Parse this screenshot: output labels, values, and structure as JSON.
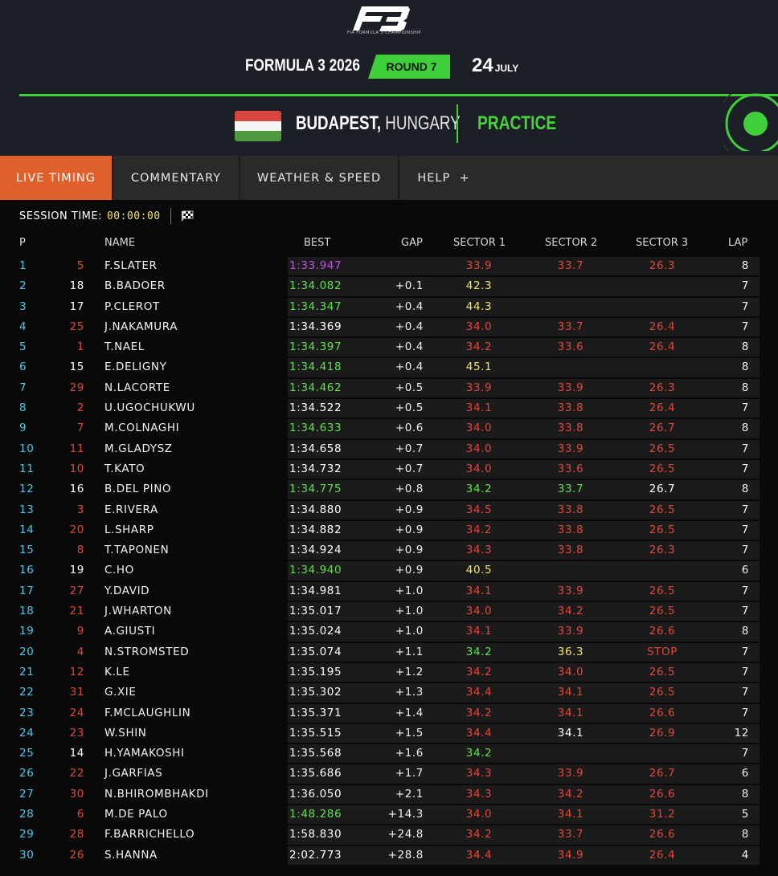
{
  "header": {
    "logo_text": "F3",
    "logo_sub": "FIA FORMULA 3 CHAMPIONSHIP",
    "season": "FORMULA 3 2026",
    "round": "ROUND 7",
    "day": "24",
    "month": "JULY",
    "city": "BUDAPEST,",
    "country": "HUNGARY",
    "session": "PRACTICE"
  },
  "colors": {
    "accent_green": "#3ecf3a",
    "active_tab": "#e0602c",
    "purple": "#c44fe0",
    "green": "#5ee04f",
    "yellow": "#f4e46a",
    "red": "#e0473b",
    "white": "#ffffff",
    "cyan": "#4ac9e6"
  },
  "tabs": [
    "LIVE TIMING",
    "COMMENTARY",
    "WEATHER & SPEED",
    "HELP  +"
  ],
  "session_bar": {
    "label": "SESSION TIME:",
    "time": "00:00:00",
    "icon": "checkered-flag-icon"
  },
  "columns": {
    "pos": "P",
    "name": "NAME",
    "best": "BEST",
    "gap": "GAP",
    "s1": "SECTOR 1",
    "s2": "SECTOR 2",
    "s3": "SECTOR 3",
    "lap": "LAP"
  },
  "rows": [
    {
      "pos": "1",
      "num": "5",
      "num_c": "red",
      "name": "F.SLATER",
      "best": "1:33.947",
      "best_c": "purple",
      "gap": "",
      "s1": "33.9",
      "s1_c": "red",
      "s2": "33.7",
      "s2_c": "red",
      "s3": "26.3",
      "s3_c": "red",
      "lap": "8"
    },
    {
      "pos": "2",
      "num": "18",
      "num_c": "white",
      "name": "B.BADOER",
      "best": "1:34.082",
      "best_c": "green",
      "gap": "+0.1",
      "s1": "42.3",
      "s1_c": "yellow",
      "s2": "",
      "s2_c": "white",
      "s3": "",
      "s3_c": "white",
      "lap": "7"
    },
    {
      "pos": "3",
      "num": "17",
      "num_c": "white",
      "name": "P.CLEROT",
      "best": "1:34.347",
      "best_c": "green",
      "gap": "+0.4",
      "s1": "44.3",
      "s1_c": "yellow",
      "s2": "",
      "s2_c": "white",
      "s3": "",
      "s3_c": "white",
      "lap": "7"
    },
    {
      "pos": "4",
      "num": "25",
      "num_c": "red",
      "name": "J.NAKAMURA",
      "best": "1:34.369",
      "best_c": "white",
      "gap": "+0.4",
      "s1": "34.0",
      "s1_c": "red",
      "s2": "33.7",
      "s2_c": "red",
      "s3": "26.4",
      "s3_c": "red",
      "lap": "7"
    },
    {
      "pos": "5",
      "num": "1",
      "num_c": "red",
      "name": "T.NAEL",
      "best": "1:34.397",
      "best_c": "green",
      "gap": "+0.4",
      "s1": "34.2",
      "s1_c": "red",
      "s2": "33.6",
      "s2_c": "red",
      "s3": "26.4",
      "s3_c": "red",
      "lap": "8"
    },
    {
      "pos": "6",
      "num": "15",
      "num_c": "white",
      "name": "E.DELIGNY",
      "best": "1:34.418",
      "best_c": "green",
      "gap": "+0.4",
      "s1": "45.1",
      "s1_c": "yellow",
      "s2": "",
      "s2_c": "white",
      "s3": "",
      "s3_c": "white",
      "lap": "8"
    },
    {
      "pos": "7",
      "num": "29",
      "num_c": "red",
      "name": "N.LACORTE",
      "best": "1:34.462",
      "best_c": "green",
      "gap": "+0.5",
      "s1": "33.9",
      "s1_c": "red",
      "s2": "33.9",
      "s2_c": "red",
      "s3": "26.3",
      "s3_c": "red",
      "lap": "8"
    },
    {
      "pos": "8",
      "num": "2",
      "num_c": "red",
      "name": "U.UGOCHUKWU",
      "best": "1:34.522",
      "best_c": "white",
      "gap": "+0.5",
      "s1": "34.1",
      "s1_c": "red",
      "s2": "33.8",
      "s2_c": "red",
      "s3": "26.4",
      "s3_c": "red",
      "lap": "7"
    },
    {
      "pos": "9",
      "num": "7",
      "num_c": "red",
      "name": "M.COLNAGHI",
      "best": "1:34.633",
      "best_c": "green",
      "gap": "+0.6",
      "s1": "34.0",
      "s1_c": "red",
      "s2": "33.8",
      "s2_c": "red",
      "s3": "26.7",
      "s3_c": "red",
      "lap": "8"
    },
    {
      "pos": "10",
      "num": "11",
      "num_c": "red",
      "name": "M.GLADYSZ",
      "best": "1:34.658",
      "best_c": "white",
      "gap": "+0.7",
      "s1": "34.0",
      "s1_c": "red",
      "s2": "33.9",
      "s2_c": "red",
      "s3": "26.5",
      "s3_c": "red",
      "lap": "7"
    },
    {
      "pos": "11",
      "num": "10",
      "num_c": "red",
      "name": "T.KATO",
      "best": "1:34.732",
      "best_c": "white",
      "gap": "+0.7",
      "s1": "34.0",
      "s1_c": "red",
      "s2": "33.6",
      "s2_c": "red",
      "s3": "26.5",
      "s3_c": "red",
      "lap": "7"
    },
    {
      "pos": "12",
      "num": "16",
      "num_c": "white",
      "name": "B.DEL PINO",
      "best": "1:34.775",
      "best_c": "green",
      "gap": "+0.8",
      "s1": "34.2",
      "s1_c": "green",
      "s2": "33.7",
      "s2_c": "green",
      "s3": "26.7",
      "s3_c": "white",
      "lap": "8"
    },
    {
      "pos": "13",
      "num": "3",
      "num_c": "red",
      "name": "E.RIVERA",
      "best": "1:34.880",
      "best_c": "white",
      "gap": "+0.9",
      "s1": "34.5",
      "s1_c": "red",
      "s2": "33.8",
      "s2_c": "red",
      "s3": "26.5",
      "s3_c": "red",
      "lap": "7"
    },
    {
      "pos": "14",
      "num": "20",
      "num_c": "red",
      "name": "L.SHARP",
      "best": "1:34.882",
      "best_c": "white",
      "gap": "+0.9",
      "s1": "34.2",
      "s1_c": "red",
      "s2": "33.8",
      "s2_c": "red",
      "s3": "26.5",
      "s3_c": "red",
      "lap": "7"
    },
    {
      "pos": "15",
      "num": "8",
      "num_c": "red",
      "name": "T.TAPONEN",
      "best": "1:34.924",
      "best_c": "white",
      "gap": "+0.9",
      "s1": "34.3",
      "s1_c": "red",
      "s2": "33.8",
      "s2_c": "red",
      "s3": "26.3",
      "s3_c": "red",
      "lap": "7"
    },
    {
      "pos": "16",
      "num": "19",
      "num_c": "white",
      "name": "C.HO",
      "best": "1:34.940",
      "best_c": "green",
      "gap": "+0.9",
      "s1": "40.5",
      "s1_c": "yellow",
      "s2": "",
      "s2_c": "white",
      "s3": "",
      "s3_c": "white",
      "lap": "6"
    },
    {
      "pos": "17",
      "num": "27",
      "num_c": "red",
      "name": "Y.DAVID",
      "best": "1:34.981",
      "best_c": "white",
      "gap": "+1.0",
      "s1": "34.1",
      "s1_c": "red",
      "s2": "33.9",
      "s2_c": "red",
      "s3": "26.5",
      "s3_c": "red",
      "lap": "7"
    },
    {
      "pos": "18",
      "num": "21",
      "num_c": "red",
      "name": "J.WHARTON",
      "best": "1:35.017",
      "best_c": "white",
      "gap": "+1.0",
      "s1": "34.0",
      "s1_c": "red",
      "s2": "34.2",
      "s2_c": "red",
      "s3": "26.5",
      "s3_c": "red",
      "lap": "7"
    },
    {
      "pos": "19",
      "num": "9",
      "num_c": "red",
      "name": "A.GIUSTI",
      "best": "1:35.024",
      "best_c": "white",
      "gap": "+1.0",
      "s1": "34.1",
      "s1_c": "red",
      "s2": "33.9",
      "s2_c": "red",
      "s3": "26.6",
      "s3_c": "red",
      "lap": "8"
    },
    {
      "pos": "20",
      "num": "4",
      "num_c": "red",
      "name": "N.STROMSTED",
      "best": "1:35.074",
      "best_c": "white",
      "gap": "+1.1",
      "s1": "34.2",
      "s1_c": "green",
      "s2": "36.3",
      "s2_c": "yellow",
      "s3": "STOP",
      "s3_c": "red",
      "lap": "7"
    },
    {
      "pos": "21",
      "num": "12",
      "num_c": "red",
      "name": "K.LE",
      "best": "1:35.195",
      "best_c": "white",
      "gap": "+1.2",
      "s1": "34.2",
      "s1_c": "red",
      "s2": "34.0",
      "s2_c": "red",
      "s3": "26.5",
      "s3_c": "red",
      "lap": "7"
    },
    {
      "pos": "22",
      "num": "31",
      "num_c": "red",
      "name": "G.XIE",
      "best": "1:35.302",
      "best_c": "white",
      "gap": "+1.3",
      "s1": "34.4",
      "s1_c": "red",
      "s2": "34.1",
      "s2_c": "red",
      "s3": "26.5",
      "s3_c": "red",
      "lap": "7"
    },
    {
      "pos": "23",
      "num": "24",
      "num_c": "red",
      "name": "F.MCLAUGHLIN",
      "best": "1:35.371",
      "best_c": "white",
      "gap": "+1.4",
      "s1": "34.2",
      "s1_c": "red",
      "s2": "34.1",
      "s2_c": "red",
      "s3": "26.6",
      "s3_c": "red",
      "lap": "7"
    },
    {
      "pos": "24",
      "num": "23",
      "num_c": "red",
      "name": "W.SHIN",
      "best": "1:35.515",
      "best_c": "white",
      "gap": "+1.5",
      "s1": "34.4",
      "s1_c": "red",
      "s2": "34.1",
      "s2_c": "white",
      "s3": "26.9",
      "s3_c": "red",
      "lap": "12"
    },
    {
      "pos": "25",
      "num": "14",
      "num_c": "white",
      "name": "H.YAMAKOSHI",
      "best": "1:35.568",
      "best_c": "white",
      "gap": "+1.6",
      "s1": "34.2",
      "s1_c": "green",
      "s2": "",
      "s2_c": "white",
      "s3": "",
      "s3_c": "white",
      "lap": "7"
    },
    {
      "pos": "26",
      "num": "22",
      "num_c": "red",
      "name": "J.GARFIAS",
      "best": "1:35.686",
      "best_c": "white",
      "gap": "+1.7",
      "s1": "34.3",
      "s1_c": "red",
      "s2": "33.9",
      "s2_c": "red",
      "s3": "26.7",
      "s3_c": "red",
      "lap": "6"
    },
    {
      "pos": "27",
      "num": "30",
      "num_c": "red",
      "name": "N.BHIROMBHAKDI",
      "best": "1:36.050",
      "best_c": "white",
      "gap": "+2.1",
      "s1": "34.3",
      "s1_c": "red",
      "s2": "34.2",
      "s2_c": "red",
      "s3": "26.6",
      "s3_c": "red",
      "lap": "8"
    },
    {
      "pos": "28",
      "num": "6",
      "num_c": "red",
      "name": "M.DE PALO",
      "best": "1:48.286",
      "best_c": "green",
      "gap": "+14.3",
      "s1": "34.0",
      "s1_c": "red",
      "s2": "34.1",
      "s2_c": "red",
      "s3": "31.2",
      "s3_c": "red",
      "lap": "5"
    },
    {
      "pos": "29",
      "num": "28",
      "num_c": "red",
      "name": "F.BARRICHELLO",
      "best": "1:58.830",
      "best_c": "white",
      "gap": "+24.8",
      "s1": "34.2",
      "s1_c": "red",
      "s2": "33.7",
      "s2_c": "red",
      "s3": "26.6",
      "s3_c": "red",
      "lap": "8"
    },
    {
      "pos": "30",
      "num": "26",
      "num_c": "red",
      "name": "S.HANNA",
      "best": "2:02.773",
      "best_c": "white",
      "gap": "+28.8",
      "s1": "34.4",
      "s1_c": "red",
      "s2": "34.9",
      "s2_c": "red",
      "s3": "26.4",
      "s3_c": "red",
      "lap": "4"
    }
  ]
}
